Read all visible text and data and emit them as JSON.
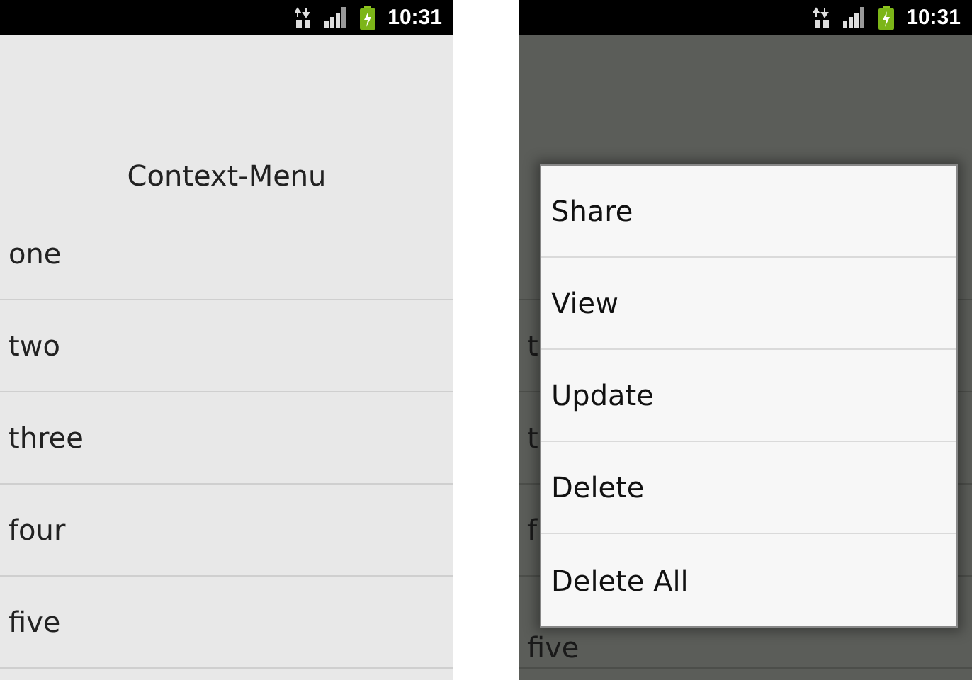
{
  "left_screen": {
    "status_bar": {
      "time": "10:31"
    },
    "title": "Context-Menu",
    "items": [
      "one",
      "two",
      "three",
      "four",
      "five"
    ]
  },
  "right_screen": {
    "status_bar": {
      "time": "10:31"
    },
    "dimmed_items": [
      "t",
      "t",
      "f",
      "five"
    ],
    "context_menu": {
      "items": [
        "Share",
        "View",
        "Update",
        "Delete",
        "Delete All"
      ]
    }
  }
}
